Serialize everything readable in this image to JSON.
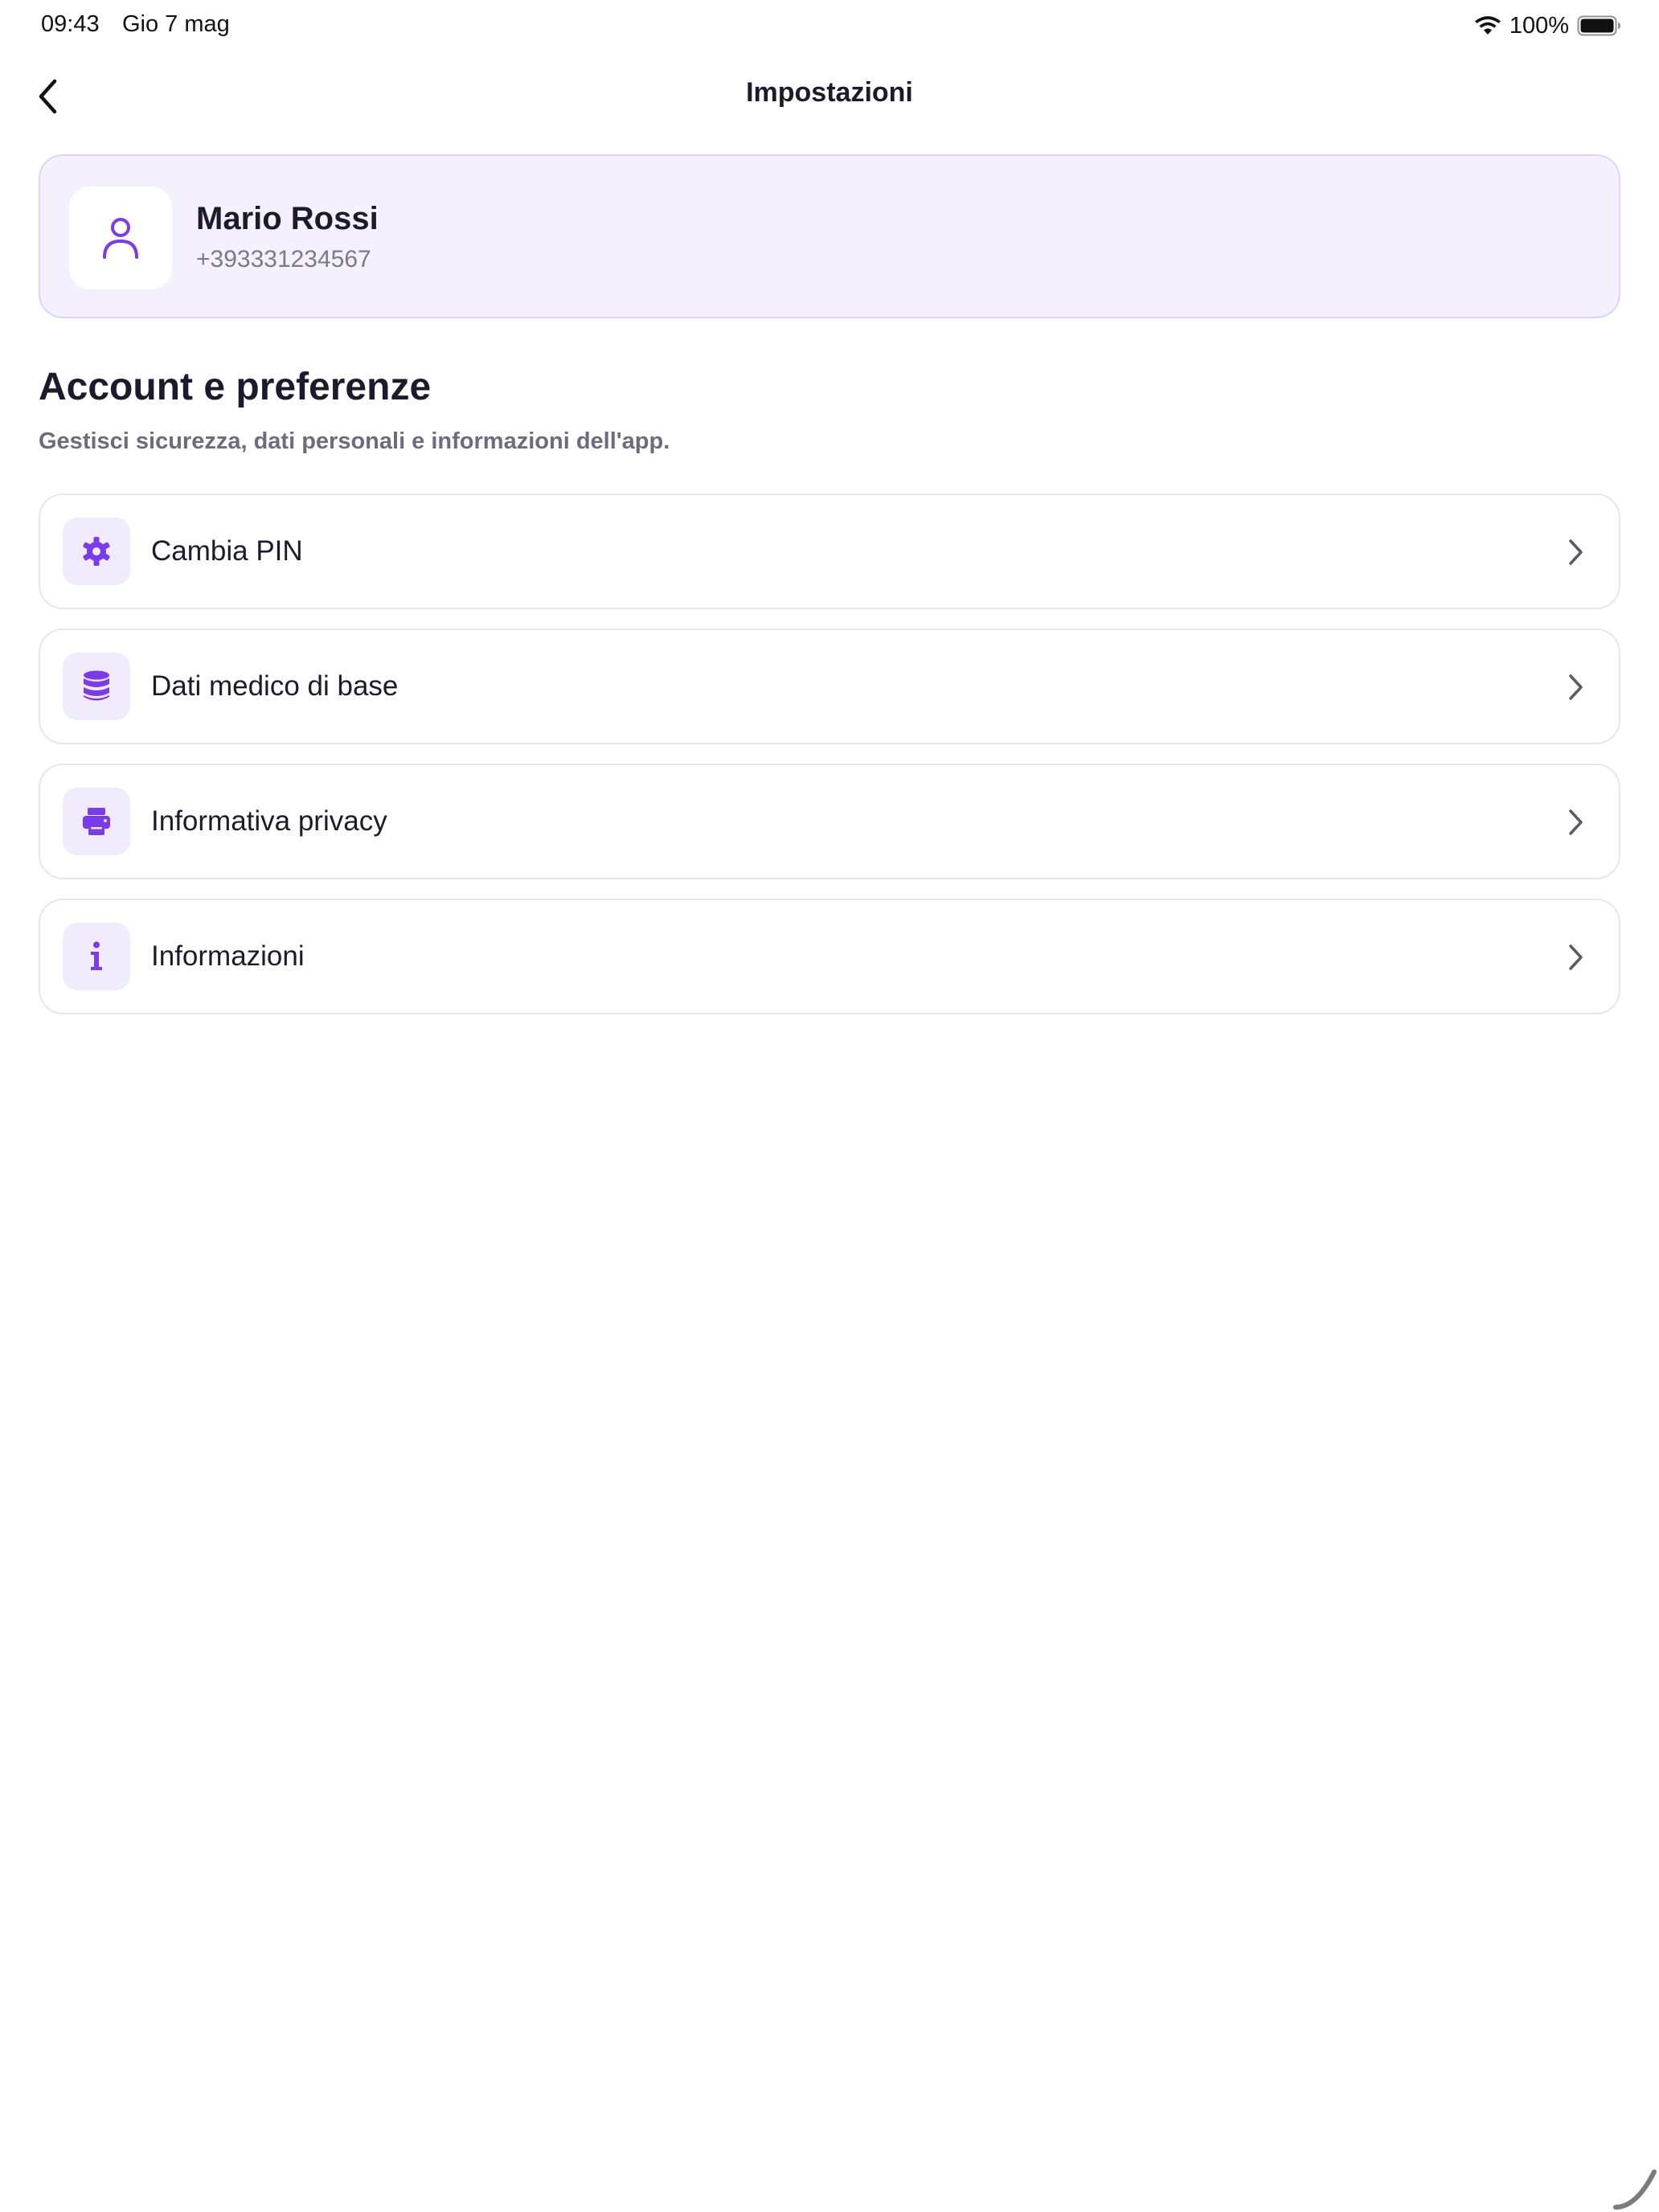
{
  "status_bar": {
    "time": "09:43",
    "date": "Gio 7 mag",
    "battery": "100%"
  },
  "nav": {
    "title": "Impostazioni"
  },
  "profile": {
    "name": "Mario Rossi",
    "phone": "+393331234567"
  },
  "section": {
    "title": "Account e preferenze",
    "subtitle": "Gestisci sicurezza, dati personali e informazioni dell'app."
  },
  "settings": {
    "items": [
      {
        "label": "Cambia PIN",
        "icon": "gear-icon"
      },
      {
        "label": "Dati medico di base",
        "icon": "database-icon"
      },
      {
        "label": "Informativa privacy",
        "icon": "printer-icon"
      },
      {
        "label": "Informazioni",
        "icon": "info-icon"
      }
    ]
  },
  "colors": {
    "accent": "#7c3aed",
    "card_bg": "#f4f0fe",
    "card_border": "#ddd3f7",
    "icon_bg": "#f1ecfd",
    "text_primary": "#1c1b2e",
    "text_secondary": "#6e6b80"
  }
}
